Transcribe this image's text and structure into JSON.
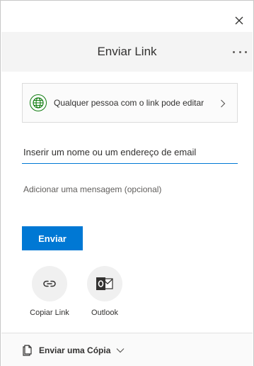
{
  "window": {
    "close_label": "×"
  },
  "header": {
    "title": "Enviar Link",
    "more_icon": "more-horizontal-icon"
  },
  "permission": {
    "text": "Qualquer pessoa com o link pode editar",
    "icon": "globe-icon",
    "accent": "#107c10"
  },
  "recipients": {
    "placeholder": "Inserir um nome ou um endereço de email"
  },
  "message": {
    "placeholder": "Adicionar uma mensagem (opcional)"
  },
  "send": {
    "label": "Enviar",
    "color": "#0078d4"
  },
  "share_options": [
    {
      "label": "Copiar Link",
      "icon": "link-icon"
    },
    {
      "label": "Outlook",
      "icon": "outlook-icon"
    }
  ],
  "footer": {
    "label": "Enviar uma Cópia",
    "icon": "copy-document-icon"
  }
}
